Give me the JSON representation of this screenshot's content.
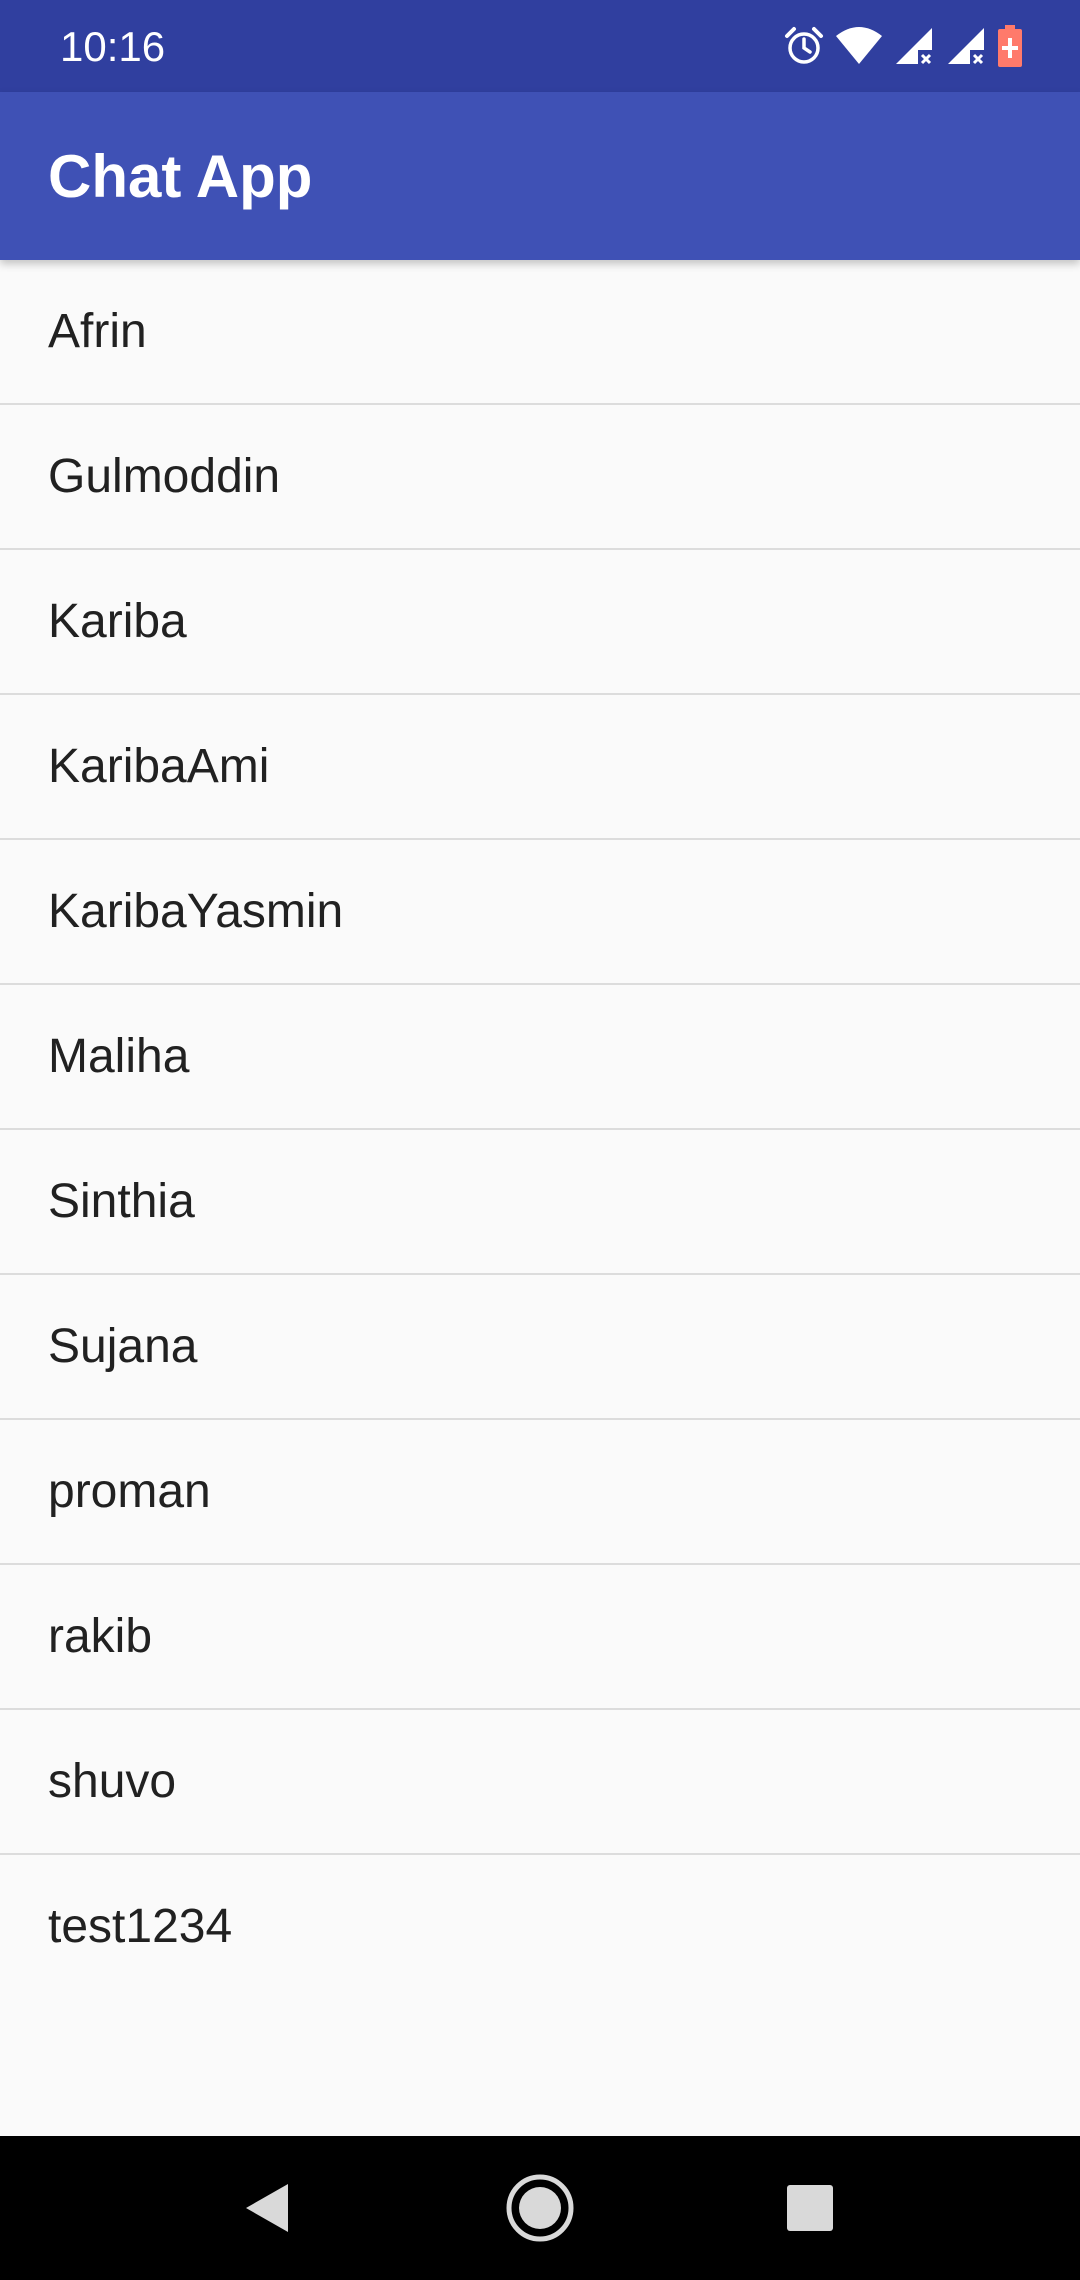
{
  "status_bar": {
    "time": "10:16",
    "icons": [
      "alarm-icon",
      "wifi-icon",
      "signal-no-data-icon",
      "signal-no-data-icon",
      "battery-charging-icon"
    ],
    "battery_color": "#ff5252"
  },
  "app_bar": {
    "title": "Chat App",
    "color": "#3f51b5"
  },
  "users": [
    {
      "name": "Afrin"
    },
    {
      "name": "Gulmoddin"
    },
    {
      "name": "Kariba"
    },
    {
      "name": "KaribaAmi"
    },
    {
      "name": "KaribaYasmin"
    },
    {
      "name": "Maliha"
    },
    {
      "name": "Sinthia"
    },
    {
      "name": "Sujana"
    },
    {
      "name": "proman"
    },
    {
      "name": "rakib"
    },
    {
      "name": "shuvo"
    },
    {
      "name": "test1234"
    }
  ],
  "nav_bar": {
    "buttons": [
      "back-icon",
      "home-icon",
      "recents-icon"
    ]
  }
}
